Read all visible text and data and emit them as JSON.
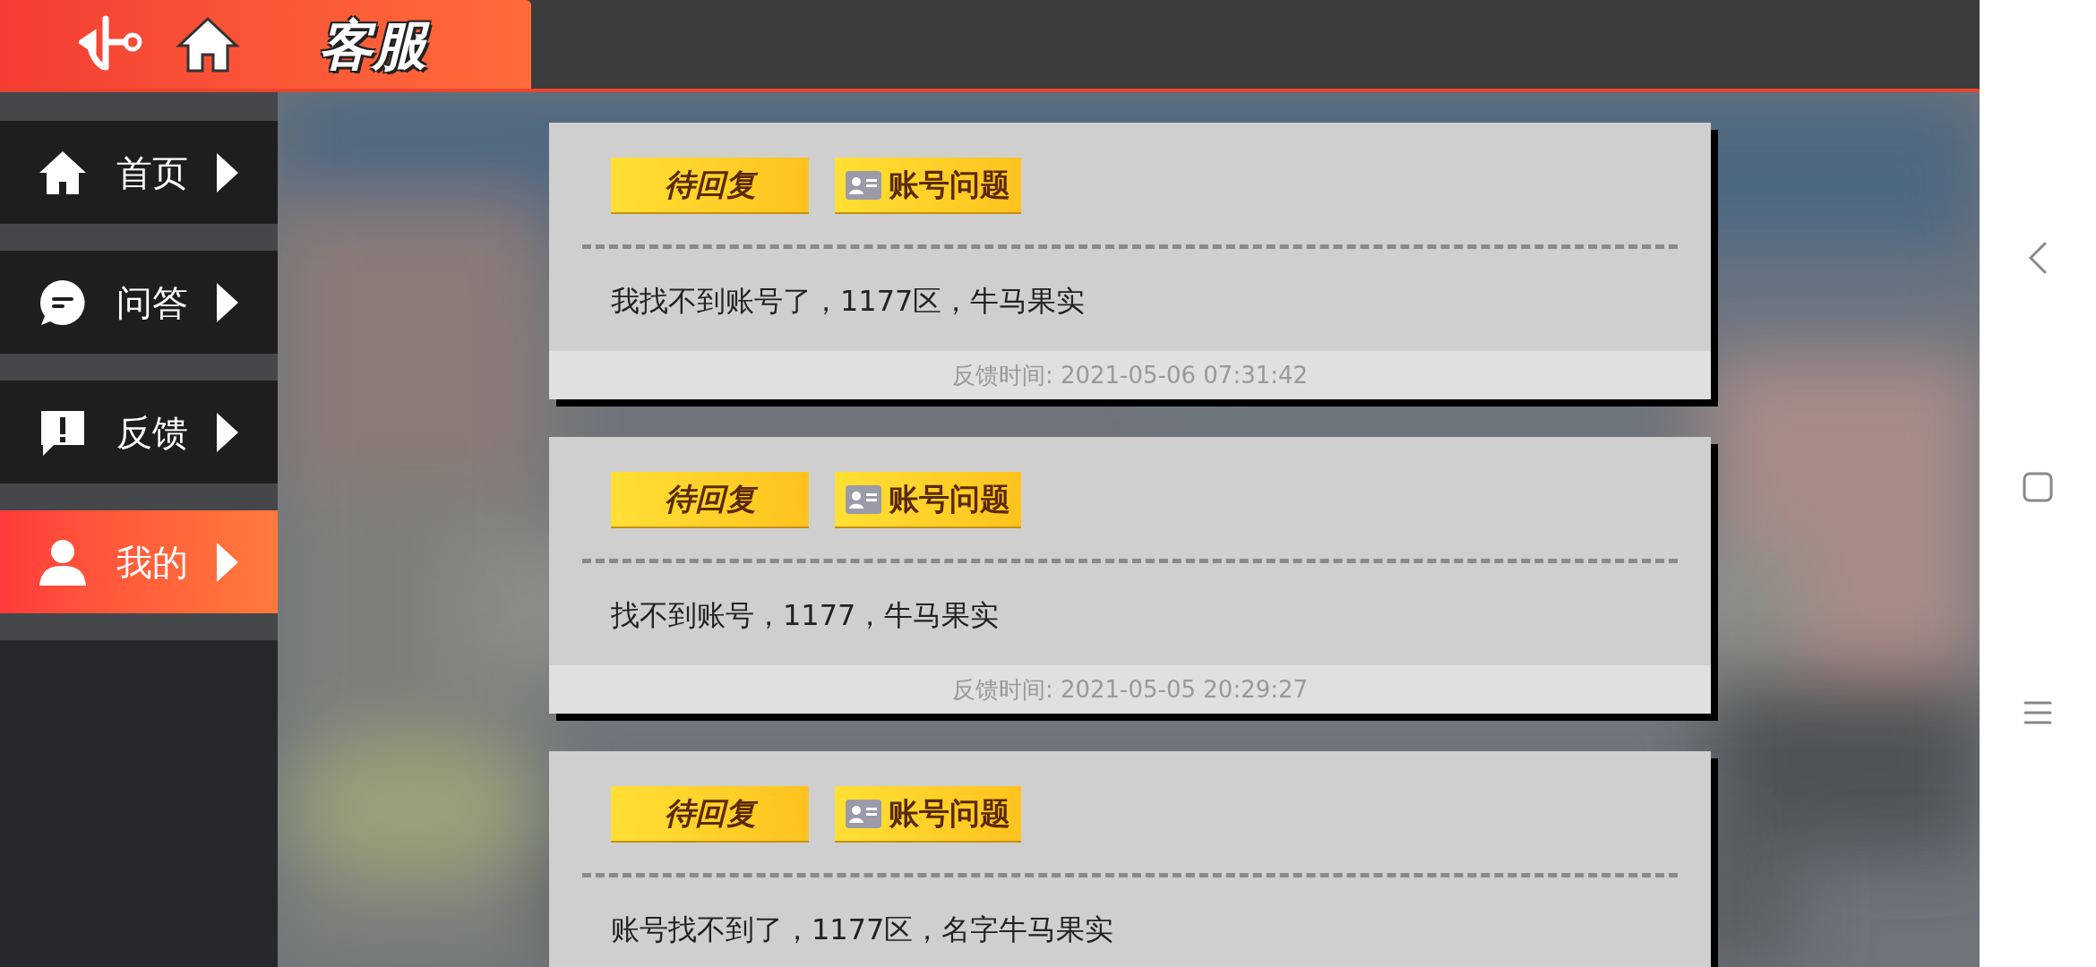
{
  "header": {
    "title": "客服"
  },
  "sidebar": {
    "items": [
      {
        "kind": "home",
        "label": "首页",
        "selected": false
      },
      {
        "kind": "chat",
        "label": "问答",
        "selected": false
      },
      {
        "kind": "alert",
        "label": "反馈",
        "selected": false
      },
      {
        "kind": "user",
        "label": "我的",
        "selected": true
      }
    ]
  },
  "tickets": [
    {
      "status": "待回复",
      "category": "账号问题",
      "message": "我找不到账号了，1177区，牛马果实",
      "time": "反馈时间: 2021-05-06 07:31:42"
    },
    {
      "status": "待回复",
      "category": "账号问题",
      "message": "找不到账号，1177，牛马果实",
      "time": "反馈时间: 2021-05-05 20:29:27"
    },
    {
      "status": "待回复",
      "category": "账号问题",
      "message": "账号找不到了，1177区，名字牛马果实"
    }
  ]
}
